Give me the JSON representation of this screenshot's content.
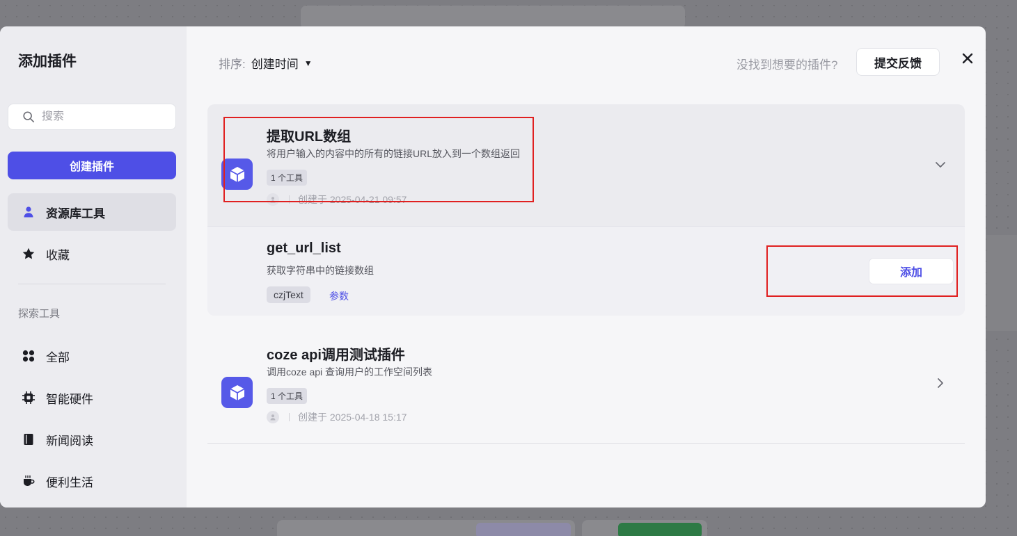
{
  "dialog": {
    "title": "添加插件",
    "search": {
      "placeholder": "搜索",
      "value": ""
    },
    "create_label": "创建插件",
    "nav": [
      {
        "label": "资源库工具",
        "icon": "user-icon",
        "active": true
      },
      {
        "label": "收藏",
        "icon": "star-icon",
        "active": false
      }
    ],
    "explore_label": "探索工具",
    "categories": [
      {
        "label": "全部",
        "icon": "grid-icon"
      },
      {
        "label": "智能硬件",
        "icon": "chip-icon"
      },
      {
        "label": "新闻阅读",
        "icon": "book-icon"
      },
      {
        "label": "便利生活",
        "icon": "cup-icon"
      }
    ]
  },
  "toolbar": {
    "sort_label": "排序:",
    "sort_value": "创建时间",
    "feedback_question": "没找到想要的插件?",
    "feedback_button": "提交反馈"
  },
  "plugins": [
    {
      "title": "提取URL数组",
      "description": "将用户输入的内容中的所有的链接URL放入到一个数组返回",
      "badge": "1 个工具",
      "created": "创建于 2025-04-21 09:57",
      "expanded": true,
      "tools": [
        {
          "name": "get_url_list",
          "description": "获取字符串中的链接数组",
          "tag": "czjText",
          "params_label": "参数",
          "add_label": "添加"
        }
      ]
    },
    {
      "title": "coze api调用测试插件",
      "description": "调用coze api 查询用户的工作空间列表",
      "badge": "1 个工具",
      "created": "创建于 2025-04-18 15:17",
      "expanded": false
    }
  ],
  "colors": {
    "accent": "#4e4fe6",
    "highlight_box": "#e02020"
  }
}
